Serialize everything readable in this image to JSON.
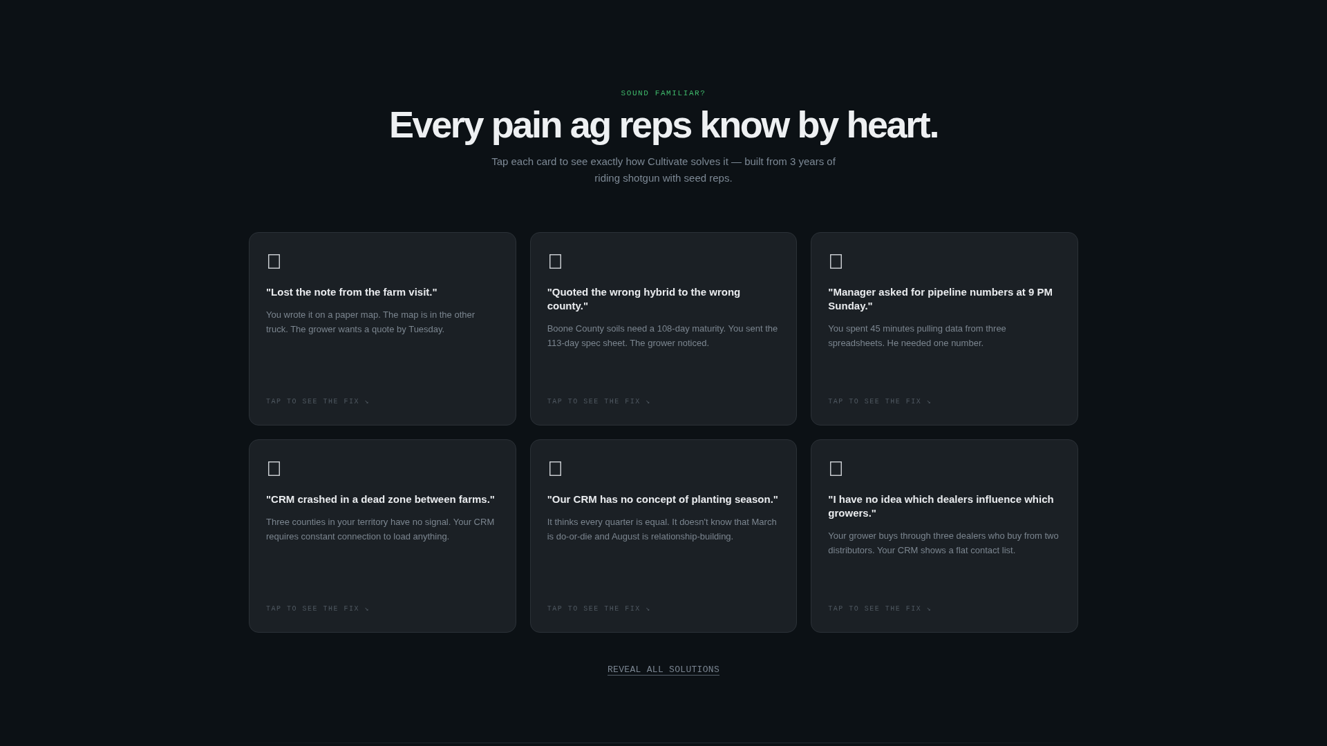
{
  "section": {
    "eyebrow": "SOUND FAMILIAR?",
    "heading": "Every pain ag reps know by heart.",
    "subheading": "Tap each card to see exactly how Cultivate solves it — built from 3 years of riding shotgun with seed reps."
  },
  "cards": [
    {
      "title": "\"Lost the note from the farm visit.\"",
      "description": "You wrote it on a paper map. The map is in the other truck. The grower wants a quote by Tuesday.",
      "hint": "TAP TO SEE THE FIX ↘"
    },
    {
      "title": "\"Quoted the wrong hybrid to the wrong county.\"",
      "description": "Boone County soils need a 108-day maturity. You sent the 113-day spec sheet. The grower noticed.",
      "hint": "TAP TO SEE THE FIX ↘"
    },
    {
      "title": "\"Manager asked for pipeline numbers at 9 PM Sunday.\"",
      "description": "You spent 45 minutes pulling data from three spreadsheets. He needed one number.",
      "hint": "TAP TO SEE THE FIX ↘"
    },
    {
      "title": "\"CRM crashed in a dead zone between farms.\"",
      "description": "Three counties in your territory have no signal. Your CRM requires constant connection to load anything.",
      "hint": "TAP TO SEE THE FIX ↘"
    },
    {
      "title": "\"Our CRM has no concept of planting season.\"",
      "description": "It thinks every quarter is equal. It doesn't know that March is do-or-die and August is relationship-building.",
      "hint": "TAP TO SEE THE FIX ↘"
    },
    {
      "title": "\"I have no idea which dealers influence which growers.\"",
      "description": "Your grower buys through three dealers who buy from two distributors. Your CRM shows a flat contact list.",
      "hint": "TAP TO SEE THE FIX ↘"
    }
  ],
  "reveal_button": {
    "label": "REVEAL ALL SOLUTIONS"
  }
}
